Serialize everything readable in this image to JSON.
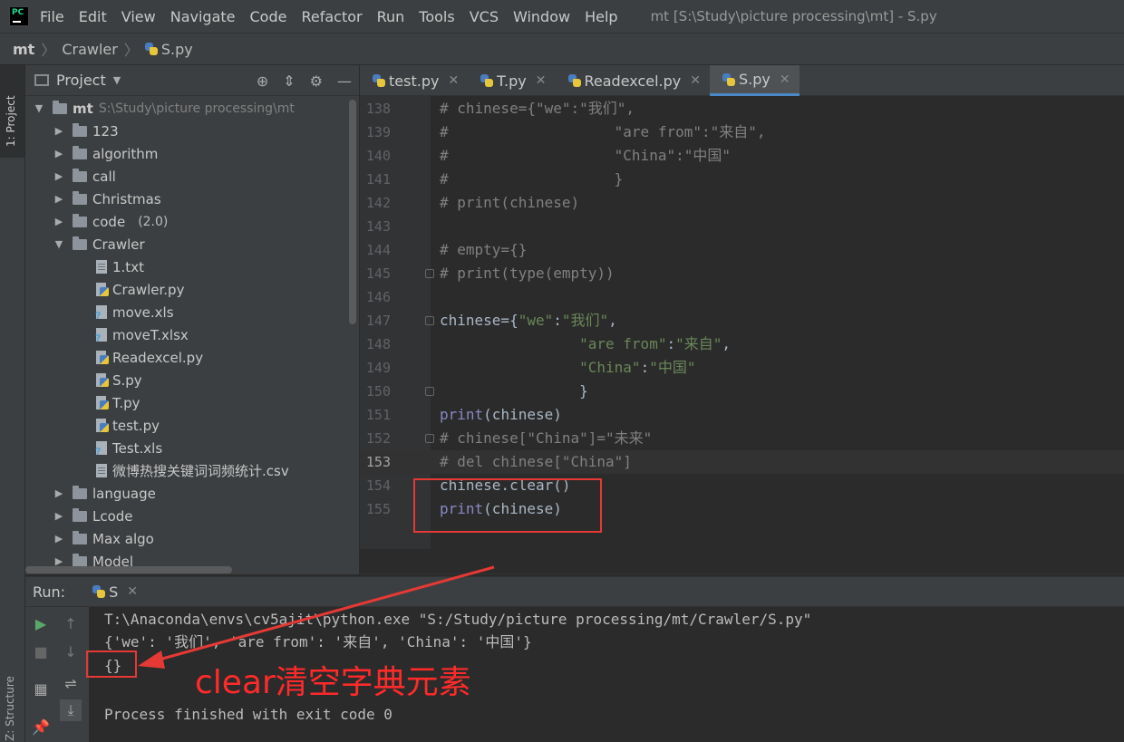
{
  "app": {
    "logo_text": "PC",
    "menu": [
      "File",
      "Edit",
      "View",
      "Navigate",
      "Code",
      "Refactor",
      "Run",
      "Tools",
      "VCS",
      "Window",
      "Help"
    ],
    "window_title": "mt [S:\\Study\\picture processing\\mt] - S.py"
  },
  "breadcrumb": [
    "mt",
    "Crawler",
    "S.py"
  ],
  "left_strip": {
    "project_label": "1: Project",
    "structure_label": "Z: Structure"
  },
  "project": {
    "title": "Project",
    "root": {
      "name": "mt",
      "path": "S:\\Study\\picture processing\\mt"
    },
    "items": [
      {
        "name": "123",
        "type": "folder"
      },
      {
        "name": "algorithm",
        "type": "folder"
      },
      {
        "name": "call",
        "type": "folder"
      },
      {
        "name": "Christmas",
        "type": "folder"
      },
      {
        "name": "code",
        "type": "folder",
        "extra": "(2.0)"
      },
      {
        "name": "Crawler",
        "type": "folder-open"
      },
      {
        "name": "1.txt",
        "type": "file"
      },
      {
        "name": "Crawler.py",
        "type": "py"
      },
      {
        "name": "move.xls",
        "type": "xls"
      },
      {
        "name": "moveT.xlsx",
        "type": "xls"
      },
      {
        "name": "Readexcel.py",
        "type": "py"
      },
      {
        "name": "S.py",
        "type": "py"
      },
      {
        "name": "T.py",
        "type": "py"
      },
      {
        "name": "test.py",
        "type": "py"
      },
      {
        "name": "Test.xls",
        "type": "xls"
      },
      {
        "name": "微博热搜关键词词频统计.csv",
        "type": "file"
      },
      {
        "name": "language",
        "type": "folder"
      },
      {
        "name": "Lcode",
        "type": "folder"
      },
      {
        "name": "Max algo",
        "type": "folder"
      },
      {
        "name": "Model",
        "type": "folder"
      }
    ]
  },
  "editor": {
    "tabs": [
      {
        "label": "test.py",
        "active": false
      },
      {
        "label": "T.py",
        "active": false
      },
      {
        "label": "Readexcel.py",
        "active": false
      },
      {
        "label": "S.py",
        "active": true
      }
    ],
    "current_line": 153,
    "lines": [
      {
        "n": "138",
        "text": "# chinese={\"we\":\"我们\",",
        "kind": "comment"
      },
      {
        "n": "139",
        "text": "#                   \"are from\":\"来自\",",
        "kind": "comment"
      },
      {
        "n": "140",
        "text": "#                   \"China\":\"中国\"",
        "kind": "comment"
      },
      {
        "n": "141",
        "text": "#                   }",
        "kind": "comment"
      },
      {
        "n": "142",
        "text": "# print(chinese)",
        "kind": "comment"
      },
      {
        "n": "143",
        "text": "",
        "kind": "plain"
      },
      {
        "n": "144",
        "text": "# empty={}",
        "kind": "comment"
      },
      {
        "n": "145",
        "text": "# print(type(empty))",
        "kind": "comment"
      },
      {
        "n": "146",
        "text": "",
        "kind": "plain"
      },
      {
        "n": "147",
        "text": "chinese={\"we\":\"我们\",",
        "kind": "code"
      },
      {
        "n": "148",
        "text": "                \"are from\":\"来自\",",
        "kind": "code"
      },
      {
        "n": "149",
        "text": "                \"China\":\"中国\"",
        "kind": "code"
      },
      {
        "n": "150",
        "text": "                }",
        "kind": "code"
      },
      {
        "n": "151",
        "text": "print(chinese)",
        "kind": "code"
      },
      {
        "n": "152",
        "text": "# chinese[\"China\"]=\"未来\"",
        "kind": "comment"
      },
      {
        "n": "153",
        "text": "# del chinese[\"China\"]",
        "kind": "comment"
      },
      {
        "n": "154",
        "text": "chinese.clear()",
        "kind": "code"
      },
      {
        "n": "155",
        "text": "print(chinese)",
        "kind": "code"
      }
    ]
  },
  "run": {
    "label": "Run:",
    "tab": "S",
    "output": [
      "T:\\Anaconda\\envs\\cv5ajit\\python.exe \"S:/Study/picture processing/mt/Crawler/S.py\"",
      "{'we': '我们', 'are from': '来自', 'China': '中国'}",
      "{}",
      "",
      "Process finished with exit code 0"
    ]
  },
  "annotation": {
    "text": "clear清空字典元素",
    "color": "#ff2a2a"
  },
  "colors": {
    "accent": "#4a88c7",
    "highlight_box": "#e53935"
  }
}
